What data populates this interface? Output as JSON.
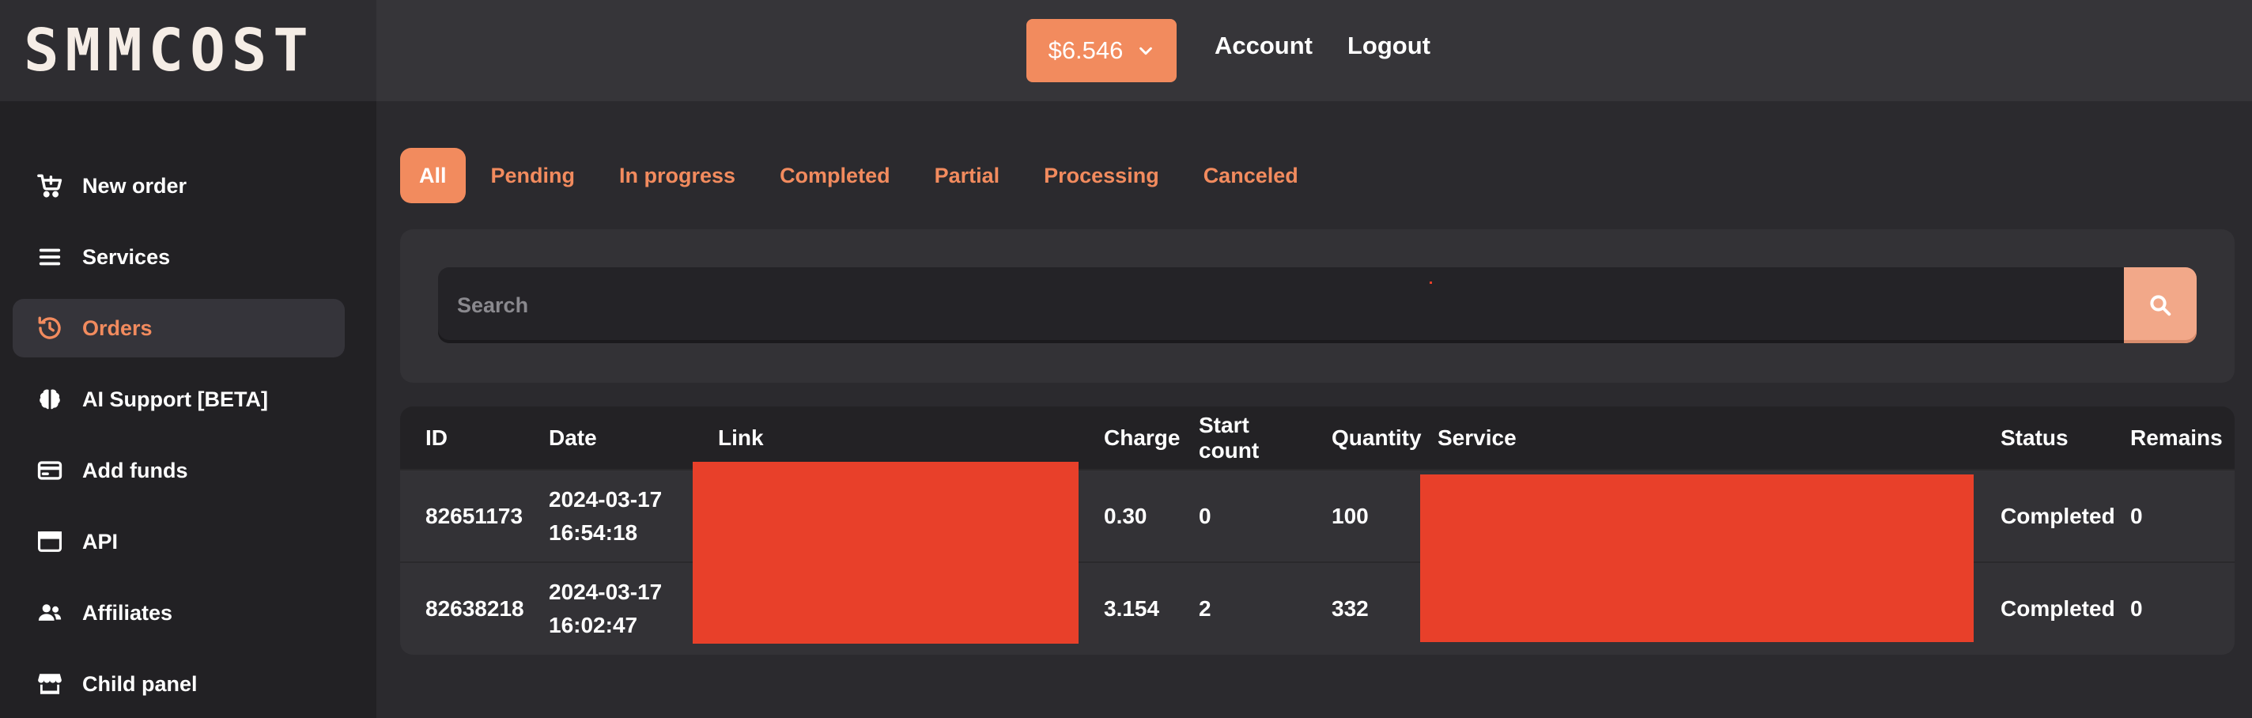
{
  "brand": {
    "logo_text": "SMMCOST"
  },
  "header": {
    "balance": "$6.546",
    "account_label": "Account",
    "logout_label": "Logout"
  },
  "sidebar": {
    "items": [
      {
        "label": "New order",
        "icon": "cart-plus-icon"
      },
      {
        "label": "Services",
        "icon": "list-icon"
      },
      {
        "label": "Orders",
        "icon": "history-icon",
        "active": true
      },
      {
        "label": "AI Support [BETA]",
        "icon": "brain-icon"
      },
      {
        "label": "Add funds",
        "icon": "credit-card-icon"
      },
      {
        "label": "API",
        "icon": "browser-window-icon"
      },
      {
        "label": "Affiliates",
        "icon": "users-icon"
      },
      {
        "label": "Child panel",
        "icon": "store-icon"
      }
    ]
  },
  "tabs": [
    {
      "label": "All",
      "active": true
    },
    {
      "label": "Pending"
    },
    {
      "label": "In progress"
    },
    {
      "label": "Completed"
    },
    {
      "label": "Partial"
    },
    {
      "label": "Processing"
    },
    {
      "label": "Canceled"
    }
  ],
  "search": {
    "placeholder": "Search",
    "value": ""
  },
  "table": {
    "columns": [
      "ID",
      "Date",
      "Link",
      "Charge",
      "Start count",
      "Quantity",
      "Service",
      "Status",
      "Remains"
    ],
    "rows": [
      {
        "id": "82651173",
        "date": "2024-03-17",
        "time": "16:54:18",
        "charge": "0.30",
        "start_count": "0",
        "quantity": "100",
        "status": "Completed",
        "remains": "0"
      },
      {
        "id": "82638218",
        "date": "2024-03-17",
        "time": "16:02:47",
        "charge": "3.154",
        "start_count": "2",
        "quantity": "332",
        "status": "Completed",
        "remains": "0"
      }
    ]
  },
  "colors": {
    "accent": "#f28b5e",
    "redaction": "#e8402a",
    "background": "#2b2a2e",
    "sidebar": "#222124"
  }
}
